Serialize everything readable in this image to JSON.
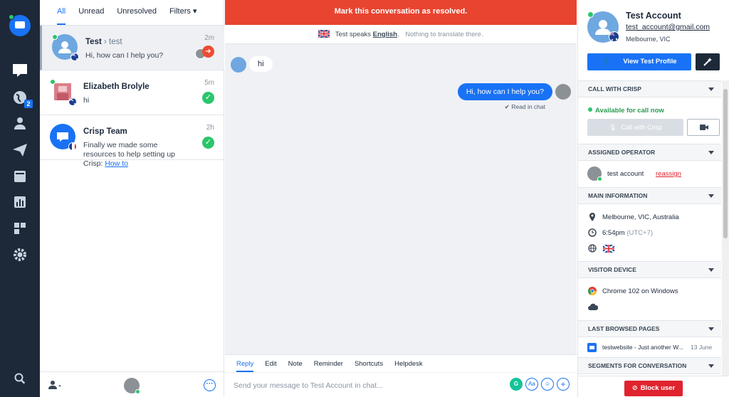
{
  "rail": {
    "badge": "2"
  },
  "filters": [
    {
      "label": "All"
    },
    {
      "label": "Unread"
    },
    {
      "label": "Unresolved"
    },
    {
      "label": "Filters ▾"
    }
  ],
  "conversations": [
    {
      "name": "Test",
      "sub": "test",
      "preview": "Hi, how can I help you?",
      "time": "2m"
    },
    {
      "name": "Elizabeth Brolyle",
      "preview": "hi",
      "time": "5m"
    },
    {
      "name": "Crisp Team",
      "preview": "Finally we made some resources to help setting up Crisp:",
      "link": "How to",
      "time": "2h"
    }
  ],
  "chat": {
    "resolve_label": "Mark this conversation as resolved.",
    "translate_prefix": "Test speaks",
    "translate_lang": "English",
    "translate_suffix": ".",
    "translate_note": "Nothing to translate there.",
    "messages": [
      {
        "from": "visitor",
        "text": "hi"
      },
      {
        "from": "operator",
        "text": "Hi, how can I help you?"
      }
    ],
    "read_label": "✔ Read in chat",
    "composer_tabs": [
      "Reply",
      "Edit",
      "Note",
      "Reminder",
      "Shortcuts",
      "Helpdesk"
    ],
    "composer_placeholder": "Send your message to Test Account in chat..."
  },
  "profile": {
    "name": "Test Account",
    "email": "test_account@gmail.com",
    "location": "Melbourne, VIC",
    "view_button": "View Test Profile",
    "call_section": "CALL WITH CRISP",
    "call_status": "Available for call now",
    "call_button": "Call with Crisp",
    "operator_section": "ASSIGNED OPERATOR",
    "operator_name": "test account",
    "reassign": "reassign",
    "main_section": "MAIN INFORMATION",
    "full_location": "Melbourne, VIC, Australia",
    "local_time": "6:54pm",
    "timezone": "(UTC+7)",
    "device_section": "VISITOR DEVICE",
    "browser": "Chrome 102 on Windows",
    "pages_section": "LAST BROWSED PAGES",
    "page_title": "testwebsite - Just another W...",
    "page_date": "13 June",
    "segments_section": "SEGMENTS FOR CONVERSATION",
    "block_button": "Block user"
  },
  "colors": {
    "accent": "#1972f5",
    "danger": "#e84430",
    "success": "#2ac66a",
    "rail": "#1d2939"
  }
}
